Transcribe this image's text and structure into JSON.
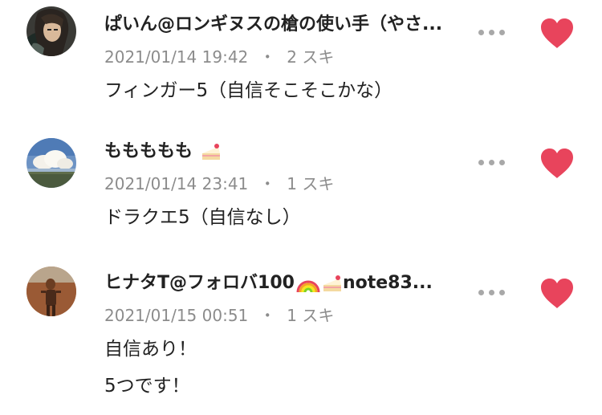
{
  "comments": [
    {
      "author": "ぱいん@ロンギヌスの槍の使い手（やさ...",
      "date": "2021/01/14 19:42",
      "separator": "・",
      "likes": "2 スキ",
      "lines": [
        "フィンガー5（自信そこそこかな）"
      ],
      "liked": true,
      "avatar_icon": "anime-character-avatar"
    },
    {
      "author": "ももももも",
      "author_emoji": "cake-icon",
      "date": "2021/01/14 23:41",
      "separator": "・",
      "likes": "1 スキ",
      "lines": [
        "ドラクエ5（自信なし）"
      ],
      "liked": true,
      "avatar_icon": "cloud-sky-avatar"
    },
    {
      "author_prefix": "ヒナタT@フォロバ100",
      "author_suffix": "note83...",
      "author_emojis": [
        "rainbow-icon",
        "cake-icon"
      ],
      "date": "2021/01/15 00:51",
      "separator": "・",
      "likes": "1 スキ",
      "lines": [
        "自信あり！",
        "5つです！"
      ],
      "liked": true,
      "avatar_icon": "person-photo-avatar"
    }
  ],
  "colors": {
    "heart": "#e8445c",
    "meta_text": "#8c8c8c",
    "more_dots": "#a8a8a8",
    "text": "#222222"
  }
}
